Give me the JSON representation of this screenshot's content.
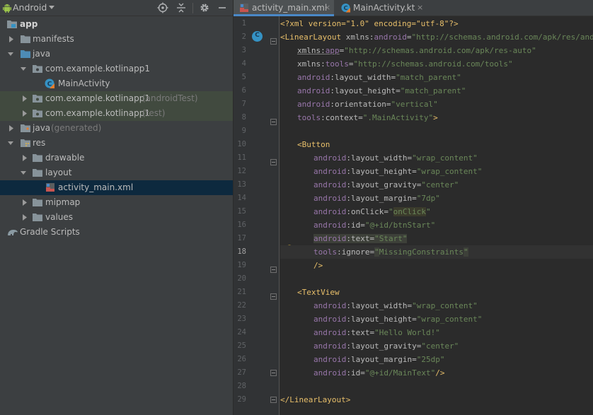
{
  "panel": {
    "view_label": "Android",
    "icons": [
      "android-icon",
      "locate-icon",
      "collapse-all-icon",
      "settings-icon",
      "hide-icon"
    ]
  },
  "tree": {
    "app": "app",
    "manifests": "manifests",
    "java": "java",
    "pkg_main": "com.example.kotlinapp1",
    "main_activity": "MainActivity",
    "pkg_android_test": "com.example.kotlinapp1",
    "pkg_android_test_suffix": "(androidTest)",
    "pkg_test": "com.example.kotlinapp1",
    "pkg_test_suffix": "(test)",
    "java_generated": "java",
    "java_generated_suffix": "(generated)",
    "res": "res",
    "drawable": "drawable",
    "layout": "layout",
    "activity_main_xml": "activity_main.xml",
    "mipmap": "mipmap",
    "values": "values",
    "gradle_scripts": "Gradle Scripts"
  },
  "tabs": [
    {
      "label": "activity_main.xml",
      "close": "×",
      "active": true
    },
    {
      "label": "MainActivity.kt",
      "close": "×",
      "active": false
    }
  ],
  "editor": {
    "current_line": 18,
    "class_marker": "C",
    "line_numbers": [
      "1",
      "2",
      "3",
      "4",
      "5",
      "6",
      "7",
      "8",
      "9",
      "10",
      "11",
      "12",
      "13",
      "14",
      "15",
      "16",
      "17",
      "18",
      "19",
      "20",
      "21",
      "22",
      "23",
      "24",
      "25",
      "26",
      "27",
      "28",
      "29"
    ]
  },
  "code": {
    "l1": {
      "a": "<?xml version=\"1.0\" encoding=\"utf-8\"?>"
    },
    "l2": {
      "tag": "<LinearLayout ",
      "ns": "xmlns:",
      "attr": "android",
      "eq": "=",
      "val": "\"http://schemas.android.com/apk/res/android\""
    },
    "l3": {
      "ns": "xmlns:",
      "attr": "app",
      "eq": "=",
      "val": "\"http://schemas.android.com/apk/res-auto\""
    },
    "l4": {
      "ns": "xmlns:",
      "attr": "tools",
      "eq": "=",
      "val": "\"http://schemas.android.com/tools\""
    },
    "l5": {
      "ns": "android",
      "attr": ":layout_width",
      "eq": "=",
      "val": "\"match_parent\""
    },
    "l6": {
      "ns": "android",
      "attr": ":layout_height",
      "eq": "=",
      "val": "\"match_parent\""
    },
    "l7": {
      "ns": "android",
      "attr": ":orientation",
      "eq": "=",
      "val": "\"vertical\""
    },
    "l8": {
      "ns": "tools",
      "attr": ":context",
      "eq": "=",
      "val": "\".MainActivity\"",
      "end": ">"
    },
    "l10": {
      "tag": "<Button"
    },
    "l11": {
      "ns": "android",
      "attr": ":layout_width",
      "eq": "=",
      "val": "\"wrap_content\""
    },
    "l12": {
      "ns": "android",
      "attr": ":layout_height",
      "eq": "=",
      "val": "\"wrap_content\""
    },
    "l13": {
      "ns": "android",
      "attr": ":layout_gravity",
      "eq": "=",
      "val": "\"center\""
    },
    "l14": {
      "ns": "android",
      "attr": ":layout_margin",
      "eq": "=",
      "val": "\"7dp\""
    },
    "l15": {
      "ns": "android",
      "attr": ":onClick",
      "eq": "=",
      "q1": "\"",
      "val": "onClick",
      "q2": "\""
    },
    "l16": {
      "ns": "android",
      "attr": ":id",
      "eq": "=",
      "val": "\"@+id/btnStart\""
    },
    "l17": {
      "ns": "android",
      "attr": ":text",
      "eq": "=",
      "val": "\"Start\""
    },
    "l18": {
      "ns": "tools",
      "attr": ":ignore",
      "eq": "=",
      "q1": "\"",
      "val": "MissingConstraints",
      "q2": "\""
    },
    "l19": {
      "tag": "/>"
    },
    "l21": {
      "tag": "<TextView"
    },
    "l22": {
      "ns": "android",
      "attr": ":layout_width",
      "eq": "=",
      "val": "\"wrap_content\""
    },
    "l23": {
      "ns": "android",
      "attr": ":layout_height",
      "eq": "=",
      "val": "\"wrap_content\""
    },
    "l24": {
      "ns": "android",
      "attr": ":text",
      "eq": "=",
      "val": "\"Hello World!\""
    },
    "l25": {
      "ns": "android",
      "attr": ":layout_gravity",
      "eq": "=",
      "val": "\"center\""
    },
    "l26": {
      "ns": "android",
      "attr": ":layout_margin",
      "eq": "=",
      "val": "\"25dp\""
    },
    "l27": {
      "ns": "android",
      "attr": ":id",
      "eq": "=",
      "val": "\"@+id/MainText\"",
      "end": "/>"
    },
    "l29": {
      "tag": "</LinearLayout>"
    }
  },
  "colors": {
    "background": "#2b2b2b",
    "panel": "#3c3f41",
    "selection": "#0d293e",
    "tag": "#e8bf6a",
    "namespace": "#9876aa",
    "value": "#6a8759",
    "accent": "#4a88c7"
  }
}
